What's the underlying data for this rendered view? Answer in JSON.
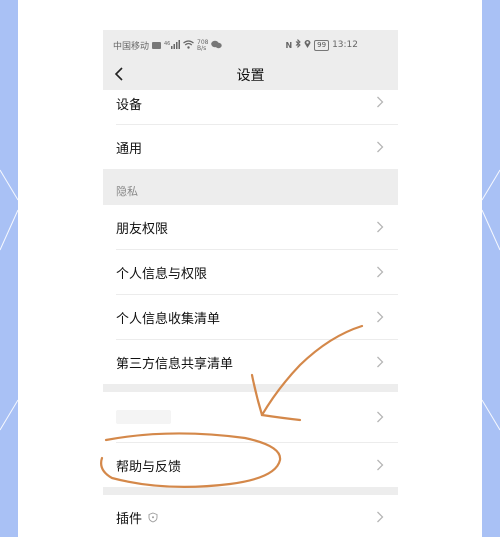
{
  "status_bar": {
    "carrier": "中国移动",
    "signal": "46",
    "speed_value": "708",
    "speed_unit": "B/s",
    "battery": "99",
    "time": "13:12"
  },
  "nav": {
    "title": "设置"
  },
  "rows": {
    "devices": "设备",
    "general": "通用",
    "privacy_header": "隐私",
    "friend_permissions": "朋友权限",
    "personal_info_permissions": "个人信息与权限",
    "personal_info_collection": "个人信息收集清单",
    "third_party_sharing": "第三方信息共享清单",
    "help_feedback": "帮助与反馈",
    "plugins": "插件"
  },
  "colors": {
    "backdrop": "#a9c1f5",
    "annotation_stroke": "#d4884a",
    "page_bg": "#ededed"
  }
}
